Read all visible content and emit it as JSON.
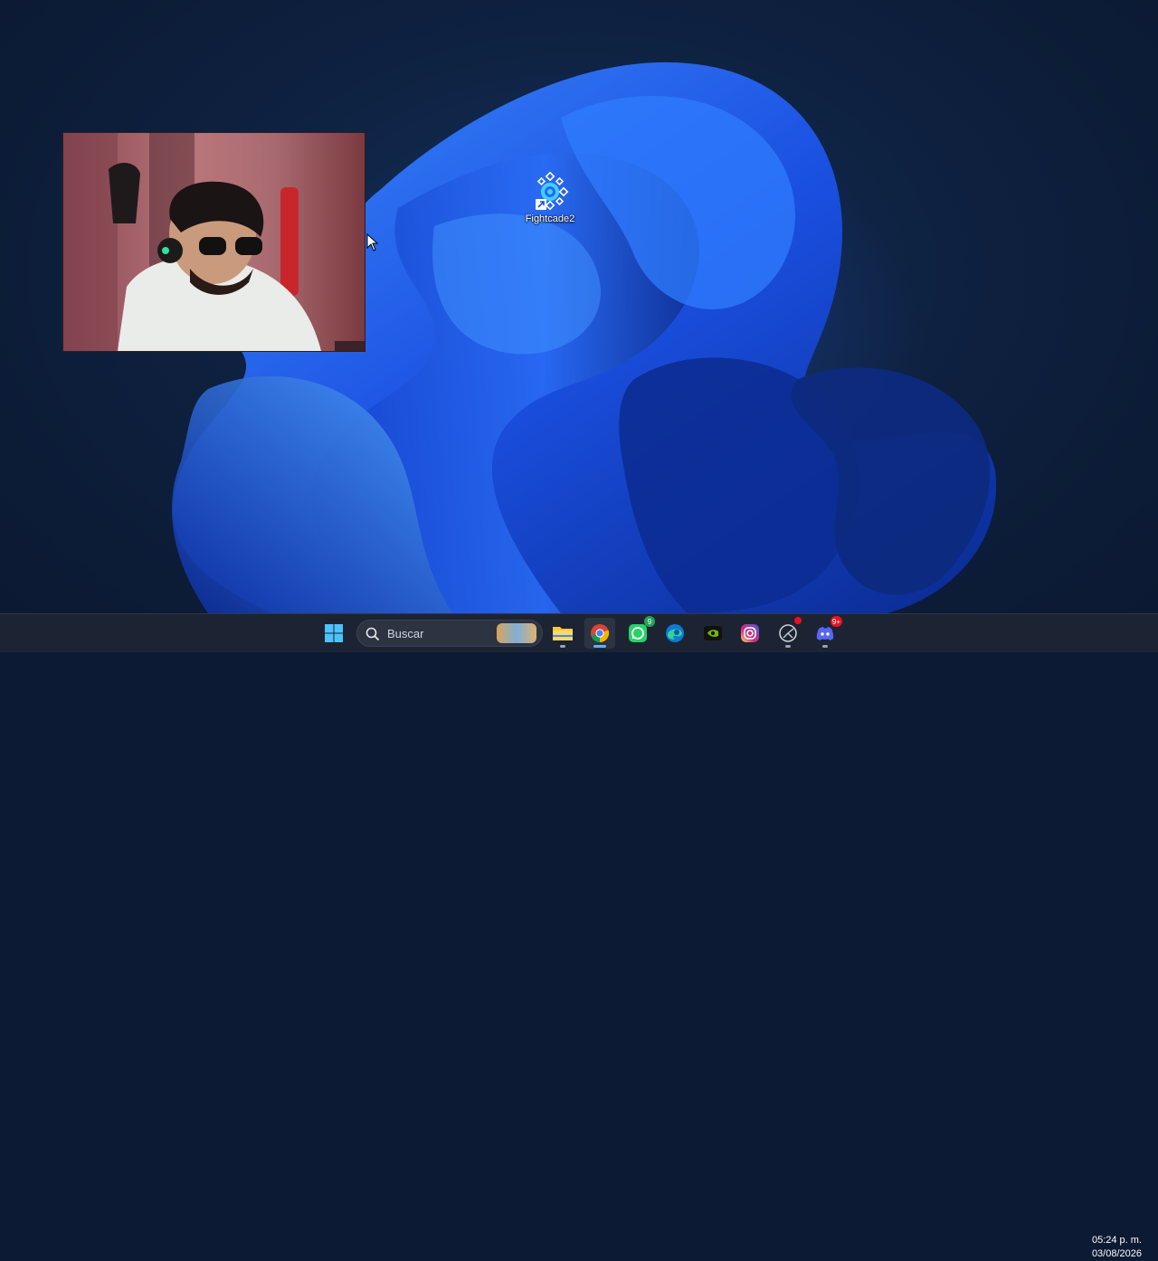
{
  "desktop": {
    "icons": [
      {
        "label": "Fightcade2",
        "icon": "fightcade-icon"
      }
    ]
  },
  "taskbar": {
    "start_icon": "windows-start-icon",
    "search": {
      "placeholder": "Buscar"
    },
    "apps": [
      {
        "name": "File Explorer",
        "icon": "folder-icon"
      },
      {
        "name": "Google Chrome",
        "icon": "chrome-icon",
        "active": true
      },
      {
        "name": "WhatsApp",
        "icon": "whatsapp-icon",
        "badge": "9"
      },
      {
        "name": "Microsoft Edge",
        "icon": "edge-icon"
      },
      {
        "name": "NVIDIA",
        "icon": "nvidia-icon"
      },
      {
        "name": "Instagram",
        "icon": "instagram-icon"
      },
      {
        "name": "Chrome app",
        "icon": "app-icon"
      },
      {
        "name": "Discord",
        "icon": "discord-icon",
        "badge": "9+"
      }
    ],
    "clock": {
      "time": "05:24 p. m.",
      "date": "03/08/2026"
    }
  },
  "colors": {
    "taskbar_bg": "#1c2433",
    "accent": "#5fb2ff",
    "wallpaper_bloom": "#1f55e6"
  }
}
